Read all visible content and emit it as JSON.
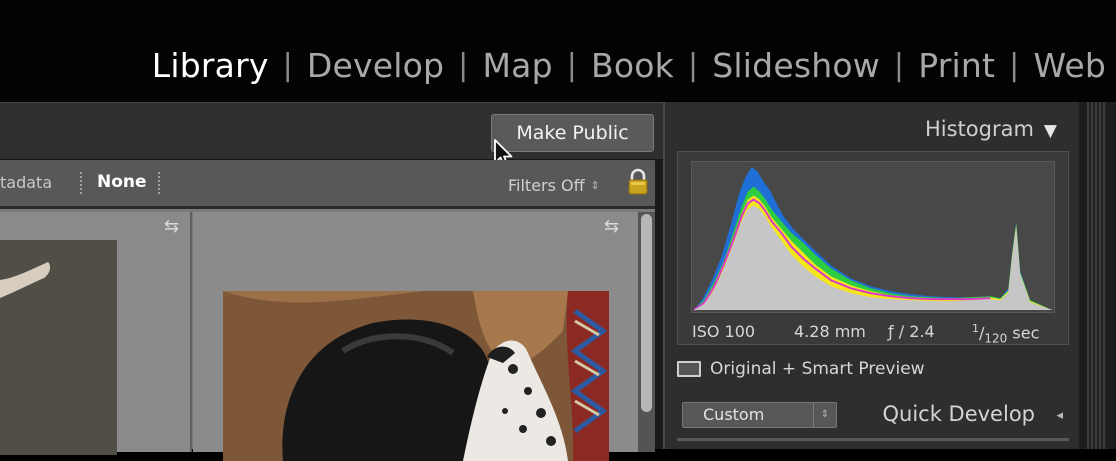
{
  "modules": {
    "items": [
      "Library",
      "Develop",
      "Map",
      "Book",
      "Slideshow",
      "Print",
      "Web"
    ],
    "active": "Library",
    "separator": "|"
  },
  "toolbar": {
    "make_public_label": "Make Public"
  },
  "filter_bar": {
    "metadata_label": "tadata",
    "none_label": "None",
    "filters_off_label": "Filters Off",
    "filters_off_arrows": "⇕"
  },
  "histogram": {
    "title": "Histogram",
    "collapse_glyph": "▼",
    "exif": {
      "iso": "ISO 100",
      "focal_length": "4.28 mm",
      "aperture": "ƒ / 2.4",
      "shutter_numerator": "1",
      "shutter_denominator": "120",
      "shutter_unit": "sec"
    },
    "preview_status": "Original + Smart Preview"
  },
  "quick_develop": {
    "title": "Quick Develop",
    "preset_value": "Custom",
    "preset_arrows": "⇕",
    "panel_glyph": "◂"
  },
  "colors": {
    "active_module": "#ffffff",
    "inactive_module": "#a8a8a8",
    "histogram_blue": "#1f6fd6",
    "histogram_green": "#2ecc40",
    "histogram_yellow": "#f4e61a",
    "histogram_magenta": "#d838c8"
  }
}
